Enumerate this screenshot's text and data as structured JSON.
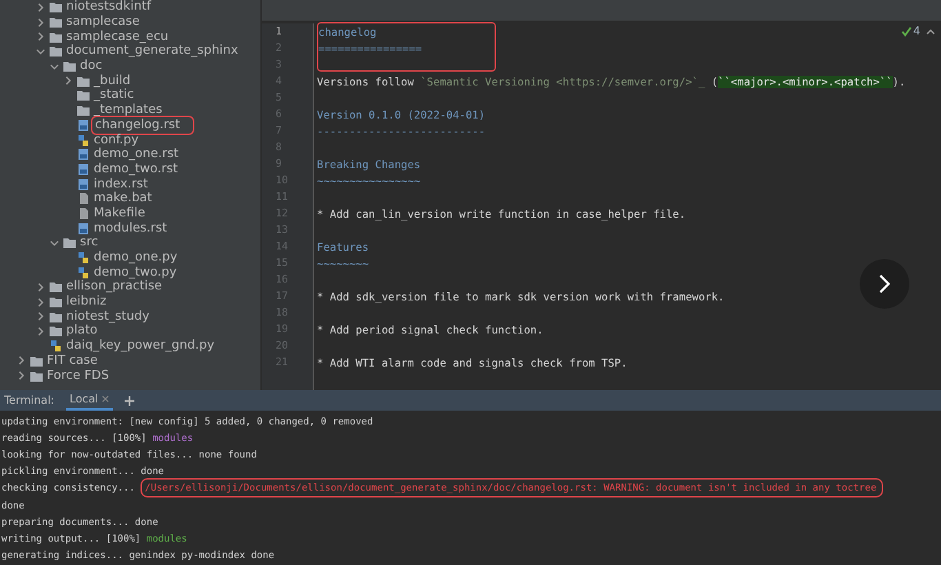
{
  "sidebar": {
    "tree": [
      {
        "label": "niotestsdkintf",
        "kind": "folder",
        "expanded": false
      },
      {
        "label": "samplecase",
        "kind": "folder",
        "expanded": false
      },
      {
        "label": "samplecase_ecu",
        "kind": "folder",
        "expanded": false
      },
      {
        "label": "document_generate_sphinx",
        "kind": "folder",
        "expanded": true,
        "children": [
          {
            "label": "doc",
            "kind": "folder",
            "expanded": true,
            "children": [
              {
                "label": "_build",
                "kind": "folder",
                "expanded": false
              },
              {
                "label": "_static",
                "kind": "plainfolder"
              },
              {
                "label": "_templates",
                "kind": "plainfolder"
              },
              {
                "label": "changelog.rst",
                "kind": "rst",
                "boxed": true
              },
              {
                "label": "conf.py",
                "kind": "py",
                "boxed": false
              },
              {
                "label": "demo_one.rst",
                "kind": "rst",
                "boxed": false
              },
              {
                "label": "demo_two.rst",
                "kind": "rst",
                "boxed": false
              },
              {
                "label": "index.rst",
                "kind": "rst",
                "boxed": false
              },
              {
                "label": "make.bat",
                "kind": "file",
                "boxed": false
              },
              {
                "label": "Makefile",
                "kind": "file",
                "boxed": false
              },
              {
                "label": "modules.rst",
                "kind": "rst",
                "boxed": false
              }
            ]
          },
          {
            "label": "src",
            "kind": "folder",
            "expanded": true,
            "children": [
              {
                "label": "demo_one.py",
                "kind": "py",
                "boxed": false
              },
              {
                "label": "demo_two.py",
                "kind": "py",
                "boxed": false
              }
            ]
          }
        ]
      },
      {
        "label": "ellison_practise",
        "kind": "folder",
        "expanded": false
      },
      {
        "label": "leibniz",
        "kind": "folder",
        "expanded": false
      },
      {
        "label": "niotest_study",
        "kind": "folder",
        "expanded": false
      },
      {
        "label": "plato",
        "kind": "folder",
        "expanded": false
      },
      {
        "label": "daiq_key_power_gnd.py",
        "kind": "py",
        "boxed": false
      }
    ],
    "root_folders": [
      {
        "label": "FIT case",
        "kind": "folder",
        "expanded": false
      },
      {
        "label": "Force FDS",
        "kind": "folder",
        "expanded": false
      }
    ]
  },
  "editor": {
    "inspections": "4",
    "lines": [
      {
        "number": "1",
        "boxed": true,
        "parts": [
          {
            "kind": "heading",
            "text": "changelog"
          }
        ]
      },
      {
        "number": "2",
        "boxed": true,
        "parts": [
          {
            "kind": "heading",
            "text": "================"
          }
        ]
      },
      {
        "number": "3",
        "boxed": false
      },
      {
        "number": "4",
        "boxed": false,
        "parts": [
          {
            "kind": "text",
            "text": "Versions follow "
          },
          {
            "kind": "link",
            "text": "`Semantic Versioning <https://semver.org/>`_"
          },
          {
            "kind": "text",
            "text": " ("
          },
          {
            "kind": "literal",
            "text": "``<major>.<minor>.<patch>``"
          },
          {
            "kind": "text",
            "text": ")."
          }
        ]
      },
      {
        "number": "5",
        "boxed": false
      },
      {
        "number": "6",
        "boxed": false,
        "parts": [
          {
            "kind": "heading",
            "text": "Version 0.1.0 (2022-04-01)"
          }
        ]
      },
      {
        "number": "7",
        "boxed": false,
        "parts": [
          {
            "kind": "heading",
            "text": "--------------------------"
          }
        ]
      },
      {
        "number": "8",
        "boxed": false
      },
      {
        "number": "9",
        "boxed": false,
        "parts": [
          {
            "kind": "heading",
            "text": "Breaking Changes"
          }
        ]
      },
      {
        "number": "10",
        "boxed": false,
        "parts": [
          {
            "kind": "heading",
            "text": "~~~~~~~~~~~~~~~~"
          }
        ]
      },
      {
        "number": "11",
        "boxed": false
      },
      {
        "number": "12",
        "boxed": false,
        "parts": [
          {
            "kind": "text",
            "text": "* Add can_lin_version write function in case_helper file."
          }
        ]
      },
      {
        "number": "13",
        "boxed": false
      },
      {
        "number": "14",
        "boxed": false,
        "parts": [
          {
            "kind": "heading",
            "text": "Features"
          }
        ]
      },
      {
        "number": "15",
        "boxed": false,
        "parts": [
          {
            "kind": "heading",
            "text": "~~~~~~~~"
          }
        ]
      },
      {
        "number": "16",
        "boxed": false
      },
      {
        "number": "17",
        "boxed": false,
        "parts": [
          {
            "kind": "text",
            "text": "* Add sdk_version file to mark sdk version work with framework."
          }
        ]
      },
      {
        "number": "18",
        "boxed": false
      },
      {
        "number": "19",
        "boxed": false,
        "parts": [
          {
            "kind": "text",
            "text": "* Add period signal check function."
          }
        ]
      },
      {
        "number": "20",
        "boxed": false
      },
      {
        "number": "21",
        "boxed": false,
        "parts": [
          {
            "kind": "text",
            "text": "* Add WTI alarm code and signals check from TSP."
          }
        ]
      }
    ]
  },
  "terminal": {
    "title": "Terminal:",
    "tabs": [
      {
        "label": "Local",
        "selected": true
      }
    ],
    "lines": [
      [
        {
          "kind": "text",
          "text": "updating environment: [new config] 5 added, 0 changed, 0 removed"
        }
      ],
      [
        {
          "kind": "text",
          "text": "reading sources... [100%] "
        },
        {
          "kind": "module",
          "text": "modules"
        }
      ],
      [
        {
          "kind": "text",
          "text": "looking for now-outdated files... none found"
        }
      ],
      [
        {
          "kind": "text",
          "text": "pickling environment... done"
        }
      ],
      [
        {
          "kind": "text",
          "text": "checking consistency... "
        },
        {
          "kind": "error",
          "text": "/Users/ellisonji/Documents/ellison/document_generate_sphinx/doc/changelog.rst: WARNING: document isn't included in any toctree"
        }
      ],
      [
        {
          "kind": "text",
          "text": "done"
        }
      ],
      [
        {
          "kind": "text",
          "text": "preparing documents... done"
        }
      ],
      [
        {
          "kind": "text",
          "text": "writing output... [100%] "
        },
        {
          "kind": "success",
          "text": "modules"
        }
      ],
      [
        {
          "kind": "text",
          "text": "generating indices... genindex py-modindex done"
        }
      ]
    ]
  }
}
